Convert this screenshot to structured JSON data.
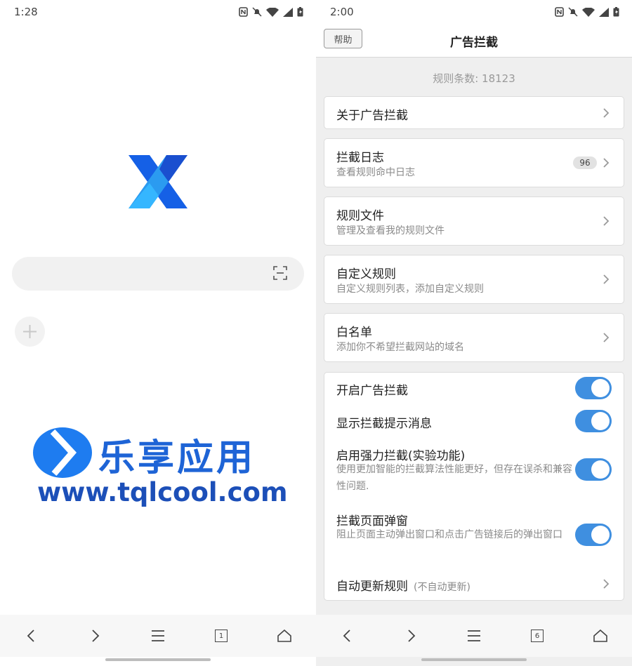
{
  "left": {
    "status": {
      "time": "1:28"
    },
    "logo": "xbrowser-logo",
    "search": {
      "placeholder": ""
    },
    "watermark": {
      "title": "乐享应用",
      "url": "www.tqlcool.com"
    },
    "nav": {
      "tab_count": "1"
    }
  },
  "right": {
    "status": {
      "time": "2:00"
    },
    "header": {
      "help_label": "帮助",
      "title": "广告拦截"
    },
    "rule_count": "规则条数: 18123",
    "menu": [
      {
        "title": "关于广告拦截",
        "subtitle": ""
      },
      {
        "title": "拦截日志",
        "subtitle": "查看规则命中日志",
        "badge": "96"
      },
      {
        "title": "规则文件",
        "subtitle": "管理及查看我的规则文件"
      },
      {
        "title": "自定义规则",
        "subtitle": "自定义规则列表，添加自定义规则"
      },
      {
        "title": "白名单",
        "subtitle": "添加你不希望拦截网站的域名"
      }
    ],
    "settings": [
      {
        "title": "开启广告拦截",
        "subtitle": "",
        "enabled": true
      },
      {
        "title": "显示拦截提示消息",
        "subtitle": "",
        "enabled": true
      },
      {
        "title": "启用强力拦截(实验功能)",
        "subtitle": "使用更加智能的拦截算法性能更好，但存在误杀和兼容性问题.",
        "enabled": true
      },
      {
        "title": "拦截页面弹窗",
        "subtitle": "阻止页面主动弹出窗口和点击广告链接后的弹出窗口",
        "enabled": true
      }
    ],
    "auto_update": {
      "title": "自动更新规则",
      "note": "(不自动更新)"
    },
    "nav": {
      "tab_count": "6"
    }
  },
  "colors": {
    "accent": "#3f8fe0",
    "background": "#efefef",
    "logo_blue": "#1e64d6"
  }
}
